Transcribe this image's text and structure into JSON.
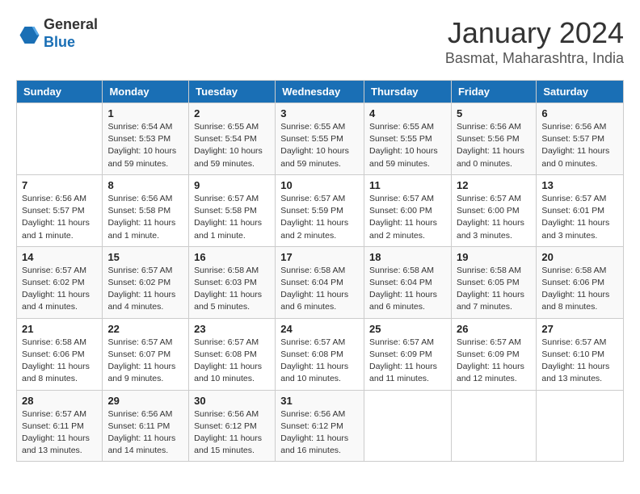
{
  "header": {
    "logo_general": "General",
    "logo_blue": "Blue",
    "month_title": "January 2024",
    "location": "Basmat, Maharashtra, India"
  },
  "days_of_week": [
    "Sunday",
    "Monday",
    "Tuesday",
    "Wednesday",
    "Thursday",
    "Friday",
    "Saturday"
  ],
  "weeks": [
    [
      {
        "day": "",
        "info": ""
      },
      {
        "day": "1",
        "info": "Sunrise: 6:54 AM\nSunset: 5:53 PM\nDaylight: 10 hours\nand 59 minutes."
      },
      {
        "day": "2",
        "info": "Sunrise: 6:55 AM\nSunset: 5:54 PM\nDaylight: 10 hours\nand 59 minutes."
      },
      {
        "day": "3",
        "info": "Sunrise: 6:55 AM\nSunset: 5:55 PM\nDaylight: 10 hours\nand 59 minutes."
      },
      {
        "day": "4",
        "info": "Sunrise: 6:55 AM\nSunset: 5:55 PM\nDaylight: 10 hours\nand 59 minutes."
      },
      {
        "day": "5",
        "info": "Sunrise: 6:56 AM\nSunset: 5:56 PM\nDaylight: 11 hours\nand 0 minutes."
      },
      {
        "day": "6",
        "info": "Sunrise: 6:56 AM\nSunset: 5:57 PM\nDaylight: 11 hours\nand 0 minutes."
      }
    ],
    [
      {
        "day": "7",
        "info": "Sunrise: 6:56 AM\nSunset: 5:57 PM\nDaylight: 11 hours\nand 1 minute."
      },
      {
        "day": "8",
        "info": "Sunrise: 6:56 AM\nSunset: 5:58 PM\nDaylight: 11 hours\nand 1 minute."
      },
      {
        "day": "9",
        "info": "Sunrise: 6:57 AM\nSunset: 5:58 PM\nDaylight: 11 hours\nand 1 minute."
      },
      {
        "day": "10",
        "info": "Sunrise: 6:57 AM\nSunset: 5:59 PM\nDaylight: 11 hours\nand 2 minutes."
      },
      {
        "day": "11",
        "info": "Sunrise: 6:57 AM\nSunset: 6:00 PM\nDaylight: 11 hours\nand 2 minutes."
      },
      {
        "day": "12",
        "info": "Sunrise: 6:57 AM\nSunset: 6:00 PM\nDaylight: 11 hours\nand 3 minutes."
      },
      {
        "day": "13",
        "info": "Sunrise: 6:57 AM\nSunset: 6:01 PM\nDaylight: 11 hours\nand 3 minutes."
      }
    ],
    [
      {
        "day": "14",
        "info": "Sunrise: 6:57 AM\nSunset: 6:02 PM\nDaylight: 11 hours\nand 4 minutes."
      },
      {
        "day": "15",
        "info": "Sunrise: 6:57 AM\nSunset: 6:02 PM\nDaylight: 11 hours\nand 4 minutes."
      },
      {
        "day": "16",
        "info": "Sunrise: 6:58 AM\nSunset: 6:03 PM\nDaylight: 11 hours\nand 5 minutes."
      },
      {
        "day": "17",
        "info": "Sunrise: 6:58 AM\nSunset: 6:04 PM\nDaylight: 11 hours\nand 6 minutes."
      },
      {
        "day": "18",
        "info": "Sunrise: 6:58 AM\nSunset: 6:04 PM\nDaylight: 11 hours\nand 6 minutes."
      },
      {
        "day": "19",
        "info": "Sunrise: 6:58 AM\nSunset: 6:05 PM\nDaylight: 11 hours\nand 7 minutes."
      },
      {
        "day": "20",
        "info": "Sunrise: 6:58 AM\nSunset: 6:06 PM\nDaylight: 11 hours\nand 8 minutes."
      }
    ],
    [
      {
        "day": "21",
        "info": "Sunrise: 6:58 AM\nSunset: 6:06 PM\nDaylight: 11 hours\nand 8 minutes."
      },
      {
        "day": "22",
        "info": "Sunrise: 6:57 AM\nSunset: 6:07 PM\nDaylight: 11 hours\nand 9 minutes."
      },
      {
        "day": "23",
        "info": "Sunrise: 6:57 AM\nSunset: 6:08 PM\nDaylight: 11 hours\nand 10 minutes."
      },
      {
        "day": "24",
        "info": "Sunrise: 6:57 AM\nSunset: 6:08 PM\nDaylight: 11 hours\nand 10 minutes."
      },
      {
        "day": "25",
        "info": "Sunrise: 6:57 AM\nSunset: 6:09 PM\nDaylight: 11 hours\nand 11 minutes."
      },
      {
        "day": "26",
        "info": "Sunrise: 6:57 AM\nSunset: 6:09 PM\nDaylight: 11 hours\nand 12 minutes."
      },
      {
        "day": "27",
        "info": "Sunrise: 6:57 AM\nSunset: 6:10 PM\nDaylight: 11 hours\nand 13 minutes."
      }
    ],
    [
      {
        "day": "28",
        "info": "Sunrise: 6:57 AM\nSunset: 6:11 PM\nDaylight: 11 hours\nand 13 minutes."
      },
      {
        "day": "29",
        "info": "Sunrise: 6:56 AM\nSunset: 6:11 PM\nDaylight: 11 hours\nand 14 minutes."
      },
      {
        "day": "30",
        "info": "Sunrise: 6:56 AM\nSunset: 6:12 PM\nDaylight: 11 hours\nand 15 minutes."
      },
      {
        "day": "31",
        "info": "Sunrise: 6:56 AM\nSunset: 6:12 PM\nDaylight: 11 hours\nand 16 minutes."
      },
      {
        "day": "",
        "info": ""
      },
      {
        "day": "",
        "info": ""
      },
      {
        "day": "",
        "info": ""
      }
    ]
  ]
}
